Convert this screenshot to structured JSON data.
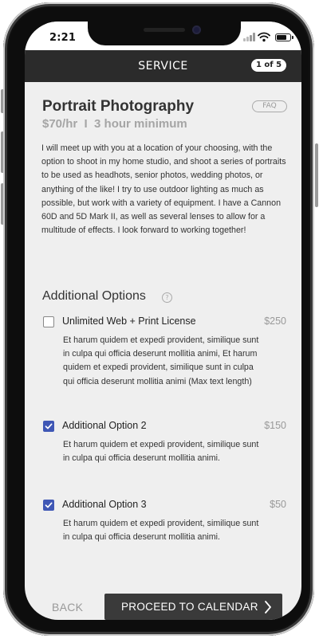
{
  "status_bar": {
    "time": "2:21",
    "battery_level": 0.8,
    "icons": [
      "signal-icon",
      "wifi-icon",
      "battery-icon"
    ]
  },
  "header": {
    "title": "SERVICE",
    "step_badge": "1 of 5"
  },
  "service": {
    "title": "Portrait Photography",
    "price": "$70/hr  I  3 hour minimum",
    "faq_label": "FAQ",
    "description": "I will meet up with you at a location of your choosing, with the option to shoot in my home studio, and shoot a series of portraits to be used as headhots, senior photos, wedding photos, or anything of the like! I try to use outdoor lighting as much as possible, but work with a variety of equipment. I have a Cannon 60D and 5D Mark II, as well as several lenses to allow for a multitude of effects. I look forward to working together!"
  },
  "options": {
    "heading": "Additional Options",
    "help_glyph": "?",
    "items": [
      {
        "label": "Unlimited Web + Print License",
        "price": "$250",
        "checked": false,
        "description": "Et harum quidem et expedi provident, similique sunt in culpa qui officia deserunt mollitia animi, Et harum quidem et expedi provident, similique sunt in culpa qui officia deserunt mollitia animi (Max text length)"
      },
      {
        "label": "Additional Option 2",
        "price": "$150",
        "checked": true,
        "description": "Et harum quidem et expedi provident, similique sunt in culpa qui officia deserunt mollitia animi."
      },
      {
        "label": "Additional Option 3",
        "price": "$50",
        "checked": true,
        "description": "Et harum quidem et expedi provident, similique sunt in culpa qui officia deserunt mollitia animi."
      }
    ]
  },
  "footer": {
    "back_label": "BACK",
    "proceed_label": "PROCEED TO CALENDAR"
  },
  "colors": {
    "header_bg": "#2b2b2b",
    "checkbox_checked": "#3f57b5",
    "proceed_bg": "#3a3a3a",
    "screen_bg": "#efefef"
  }
}
